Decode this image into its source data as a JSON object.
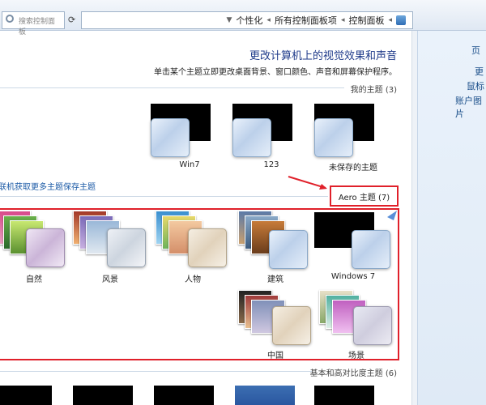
{
  "address_bar": {
    "breadcrumbs": [
      "控制面板",
      "所有控制面板项",
      "个性化"
    ],
    "search_placeholder": "搜索控制面板"
  },
  "right_pane": {
    "items": [
      "页",
      "更",
      "鼠标",
      "账户图片"
    ]
  },
  "main": {
    "title": "更改计算机上的视觉效果和声音",
    "description": "单击某个主题立即更改桌面背景、窗口颜色、声音和屏幕保护程序。",
    "my_themes_label": "我的主题 (3)",
    "my_themes": [
      {
        "label": "未保存的主题"
      },
      {
        "label": "123"
      },
      {
        "label": "Win7"
      }
    ],
    "links": {
      "save_theme": "保存主题",
      "online_themes": "联机获取更多主题"
    },
    "aero_header": "Aero 主题 (7)",
    "aero_themes": [
      {
        "label": "Windows 7"
      },
      {
        "label": "建筑"
      },
      {
        "label": "人物"
      },
      {
        "label": "风景"
      },
      {
        "label": "自然"
      },
      {
        "label": "场景"
      },
      {
        "label": "中国"
      }
    ],
    "basic_label": "基本和高对比度主题 (6)"
  },
  "colors": {
    "highlight": "#e0202a",
    "link": "#1b5aa6",
    "title": "#1e3a8a"
  }
}
